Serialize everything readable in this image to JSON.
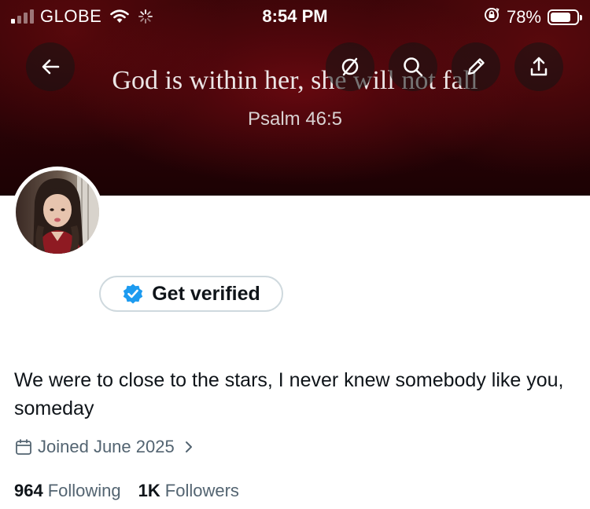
{
  "status_bar": {
    "carrier": "GLOBE",
    "time": "8:54 PM",
    "battery_percent": "78%",
    "battery_level": 0.78
  },
  "banner": {
    "verse": "God is within her, she will not fall",
    "reference": "Psalm 46:5"
  },
  "header_actions": {
    "back_icon": "arrow-left-icon",
    "grok_icon": "grok-slash-icon",
    "search_icon": "search-icon",
    "edit_icon": "pencil-icon",
    "share_icon": "share-upload-icon"
  },
  "profile": {
    "get_verified_label": "Get verified",
    "bio": "We were to close to the stars, I never knew somebody like you, someday",
    "joined": "Joined June 2025",
    "following_count": "964",
    "following_label": "Following",
    "followers_count": "1K",
    "followers_label": "Followers"
  },
  "colors": {
    "accent": "#1d9bf0",
    "text_primary": "#0f1419",
    "text_secondary": "#536471",
    "border": "#cfd9de",
    "banner_dark_red": "#3a0508"
  }
}
